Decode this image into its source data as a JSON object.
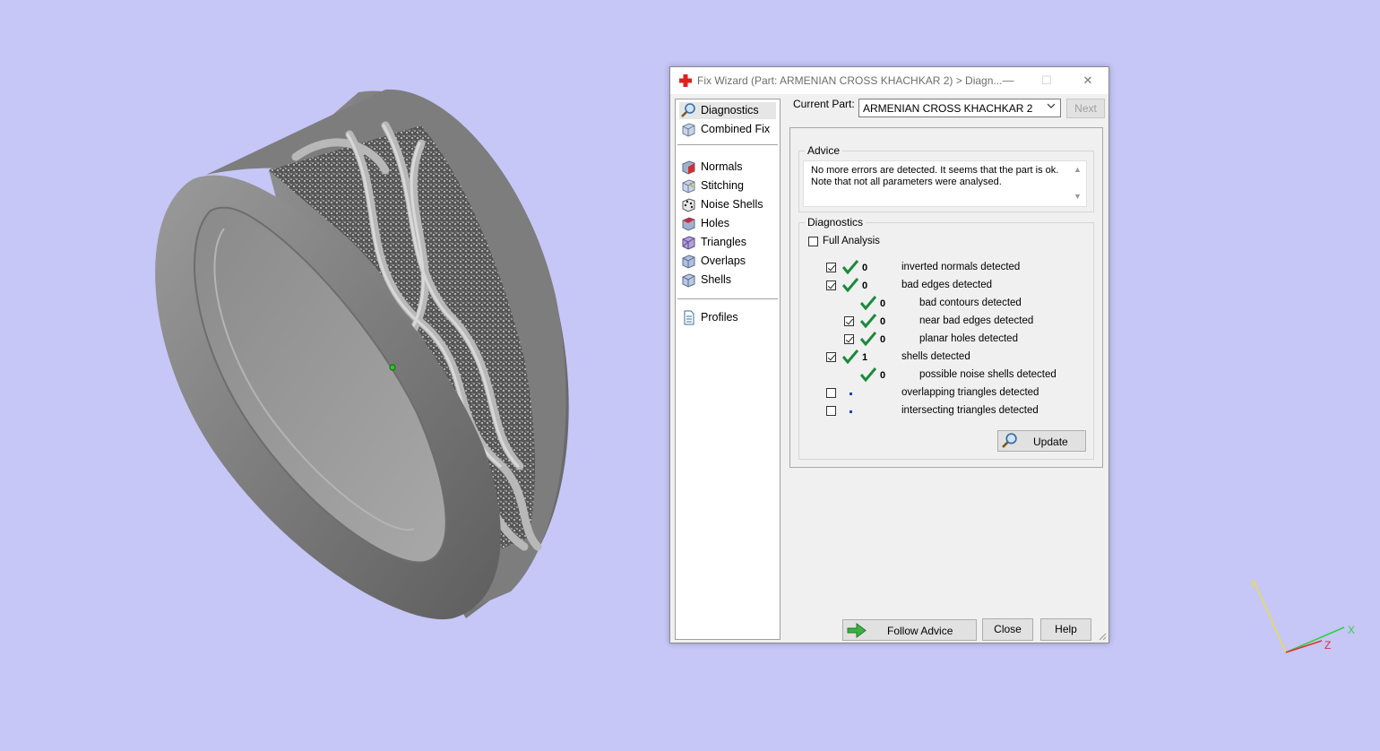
{
  "window": {
    "title": "Fix Wizard (Part: ARMENIAN CROSS KHACHKAR 2) > Diagn...",
    "minimize_glyph": "—",
    "maximize_glyph": "☐",
    "close_glyph": "✕"
  },
  "sidebar": {
    "items": [
      {
        "label": "Diagnostics",
        "icon": "magnifier-icon"
      },
      {
        "label": "Combined Fix",
        "icon": "cube-icon"
      },
      {
        "label": "Normals",
        "icon": "normals-cube-icon"
      },
      {
        "label": "Stitching",
        "icon": "stitching-cube-icon"
      },
      {
        "label": "Noise Shells",
        "icon": "dice-icon"
      },
      {
        "label": "Holes",
        "icon": "holes-cube-icon"
      },
      {
        "label": "Triangles",
        "icon": "triangles-cube-icon"
      },
      {
        "label": "Overlaps",
        "icon": "overlaps-cube-icon"
      },
      {
        "label": "Shells",
        "icon": "shells-cube-icon"
      },
      {
        "label": "Profiles",
        "icon": "document-icon"
      }
    ],
    "selected": "Diagnostics"
  },
  "current_part": {
    "label": "Current Part:",
    "value": "ARMENIAN CROSS KHACHKAR 2",
    "next_label": "Next"
  },
  "advice": {
    "title": "Advice",
    "text_line1": "No more errors are detected. It seems that the part is ok.",
    "text_line2": "Note that not all parameters were analysed."
  },
  "diagnostics": {
    "title": "Diagnostics",
    "full_analysis_label": "Full Analysis",
    "full_analysis_checked": false,
    "rows": [
      {
        "text": "inverted normals detected",
        "value": "0",
        "checkbox": true,
        "checked": true,
        "status": "ok",
        "indent": 0
      },
      {
        "text": "bad edges detected",
        "value": "0",
        "checkbox": true,
        "checked": true,
        "status": "ok",
        "indent": 0
      },
      {
        "text": "bad contours detected",
        "value": "0",
        "checkbox": false,
        "checked": false,
        "status": "ok",
        "indent": 1
      },
      {
        "text": "near bad edges detected",
        "value": "0",
        "checkbox": true,
        "checked": true,
        "status": "ok",
        "indent": 1
      },
      {
        "text": "planar holes detected",
        "value": "0",
        "checkbox": true,
        "checked": true,
        "status": "ok",
        "indent": 1
      },
      {
        "text": "shells detected",
        "value": "1",
        "checkbox": true,
        "checked": true,
        "status": "ok",
        "indent": 0
      },
      {
        "text": "possible noise shells detected",
        "value": "0",
        "checkbox": false,
        "checked": false,
        "status": "ok",
        "indent": 1
      },
      {
        "text": "overlapping triangles detected",
        "value": "",
        "checkbox": true,
        "checked": false,
        "status": "none",
        "indent": 0
      },
      {
        "text": "intersecting triangles detected",
        "value": "",
        "checkbox": true,
        "checked": false,
        "status": "none",
        "indent": 0
      }
    ],
    "update_label": "Update"
  },
  "footer": {
    "follow_advice_label": "Follow Advice",
    "close_label": "Close",
    "help_label": "Help"
  },
  "axes": {
    "x": "X",
    "y": "Y",
    "z": "Z"
  },
  "colors": {
    "viewport_bg": "#c6c6f7",
    "check_green": "#1a8a3a",
    "title_cross_red": "#e02020"
  }
}
